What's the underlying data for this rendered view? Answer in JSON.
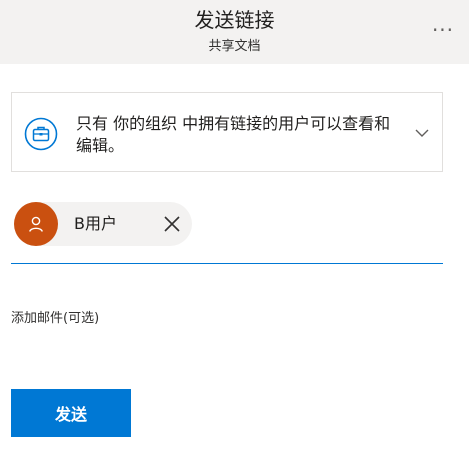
{
  "header": {
    "title": "发送链接",
    "subtitle": "共享文档",
    "more_label": "···"
  },
  "permission": {
    "icon": "briefcase-icon",
    "text": "只有 你的组织 中拥有链接的用户可以查看和编辑。",
    "chevron": "chevron-down-icon"
  },
  "recipient": {
    "name": "B用户",
    "avatar_icon": "person-icon",
    "avatar_color": "#ca5010",
    "remove_icon": "close-icon"
  },
  "message": {
    "placeholder": "添加邮件(可选)",
    "value": ""
  },
  "send": {
    "label": "发送",
    "color": "#0078d4"
  }
}
